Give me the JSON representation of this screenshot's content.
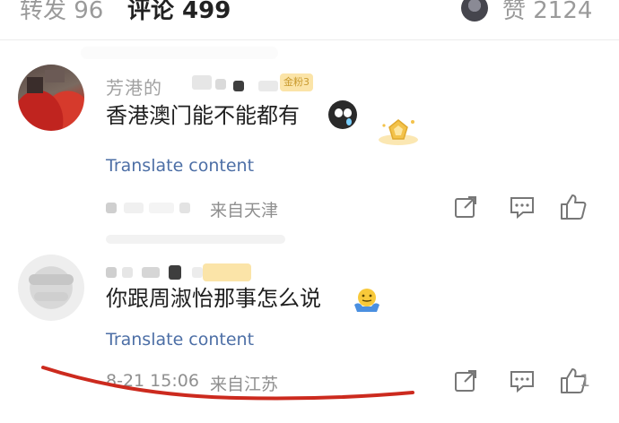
{
  "stats": {
    "repost": "转发 96",
    "comment": "评论 499",
    "like": "赞 2124"
  },
  "comments": [
    {
      "name_text": "芳港的",
      "badge": "金粉3",
      "text": "香港澳门能不能都有",
      "translate": "Translate content",
      "location": "来自天津",
      "emoji": "crying-face",
      "award": "gold-award"
    },
    {
      "badge": "",
      "text": "你跟周淑怡那事怎么说",
      "translate": "Translate content",
      "time": "8-21 15:06",
      "location": "来自江苏",
      "emoji": "shrug-face",
      "like_count": "1"
    }
  ],
  "colors": {
    "link": "#4d6fa6",
    "muted": "#8f8f8f",
    "badge_bg": "#fbe4a8",
    "badge_text": "#c99a2e",
    "underline_annotation": "#cc2a1e"
  },
  "icons": [
    "share-icon",
    "reply-icon",
    "like-icon"
  ]
}
